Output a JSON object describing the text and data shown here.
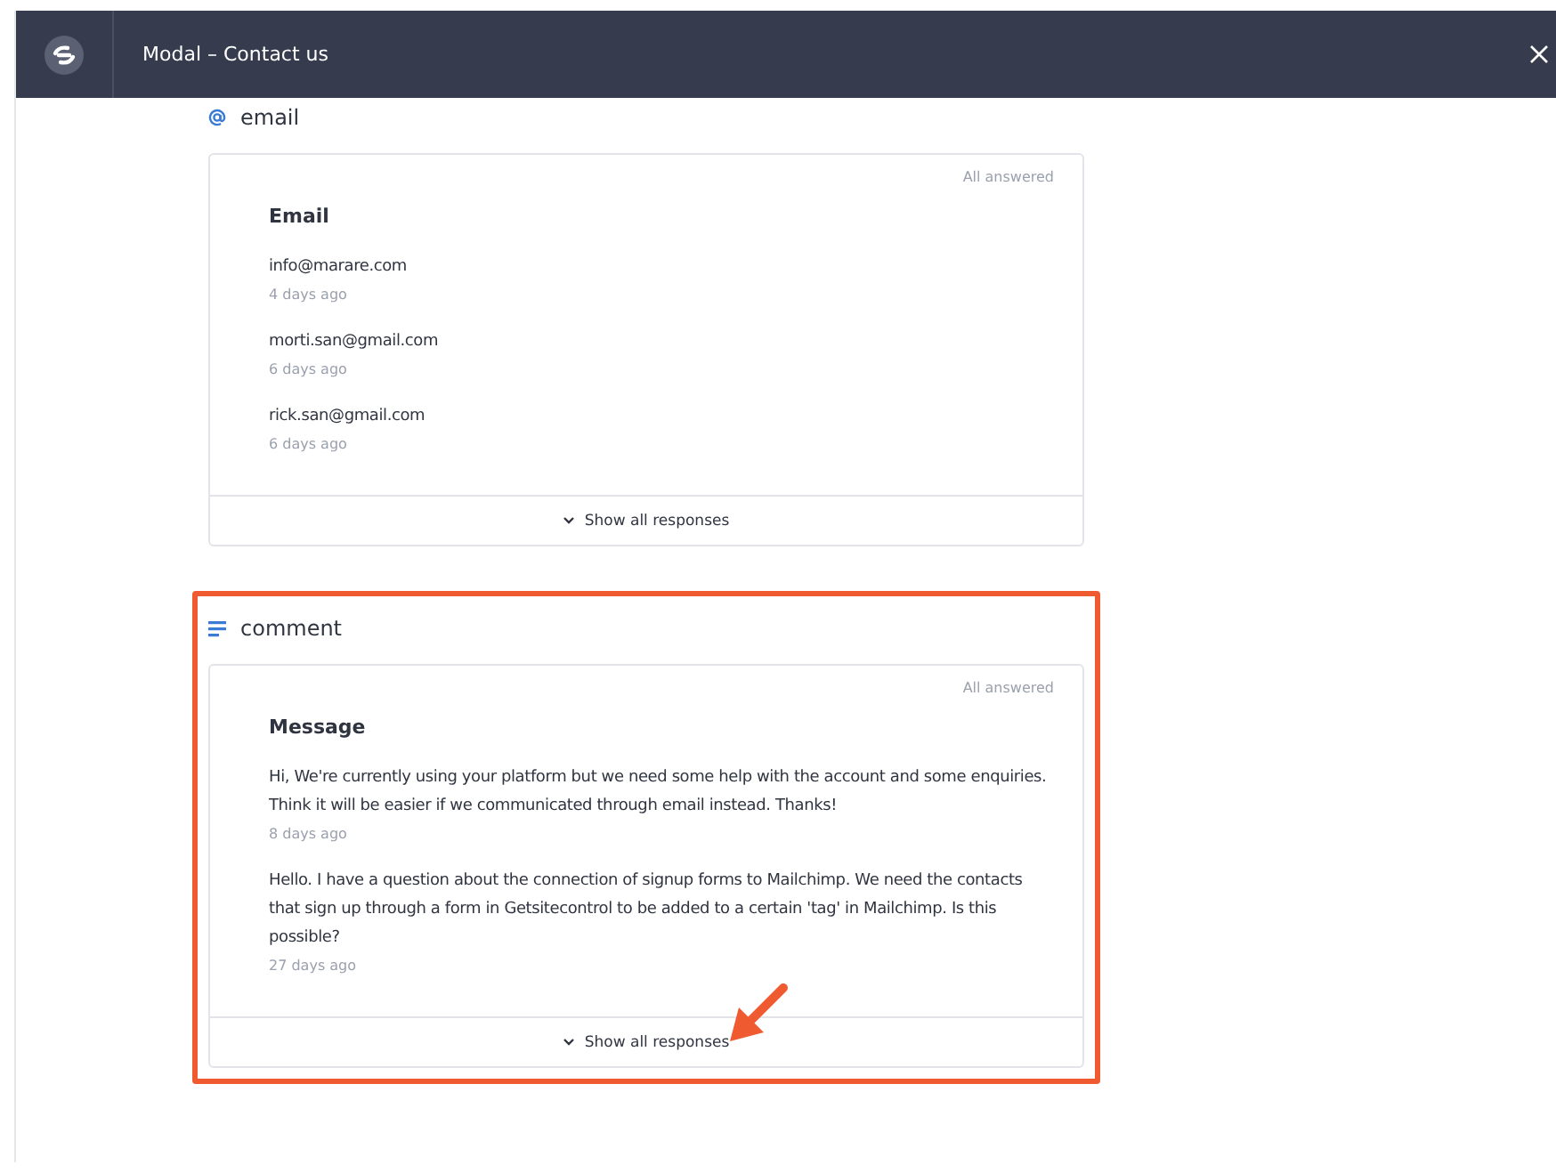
{
  "window": {
    "title": "Modal – Contact us"
  },
  "sections": [
    {
      "kind": "email",
      "label": "email",
      "highlighted": false,
      "status": "All answered",
      "title": "Email",
      "responses": [
        {
          "text": "info@marare.com",
          "time": "4 days ago"
        },
        {
          "text": "morti.san@gmail.com",
          "time": "6 days ago"
        },
        {
          "text": "rick.san@gmail.com",
          "time": "6 days ago"
        }
      ],
      "footer": "Show all responses",
      "pointer": false
    },
    {
      "kind": "text",
      "label": "comment",
      "highlighted": true,
      "status": "All answered",
      "title": "Message",
      "responses": [
        {
          "text": "Hi, We're currently using your platform but we need some help with the account and some enquiries. Think it will be easier if we communicated through email instead. Thanks!",
          "time": "8 days ago"
        },
        {
          "text": "Hello. I have a question about the connection of signup forms to Mailchimp. We need the contacts that sign up through a form in Getsitecontrol to be added to a certain 'tag' in Mailchimp. Is this possible?",
          "time": "27 days ago"
        }
      ],
      "footer": "Show all responses",
      "pointer": true
    }
  ]
}
